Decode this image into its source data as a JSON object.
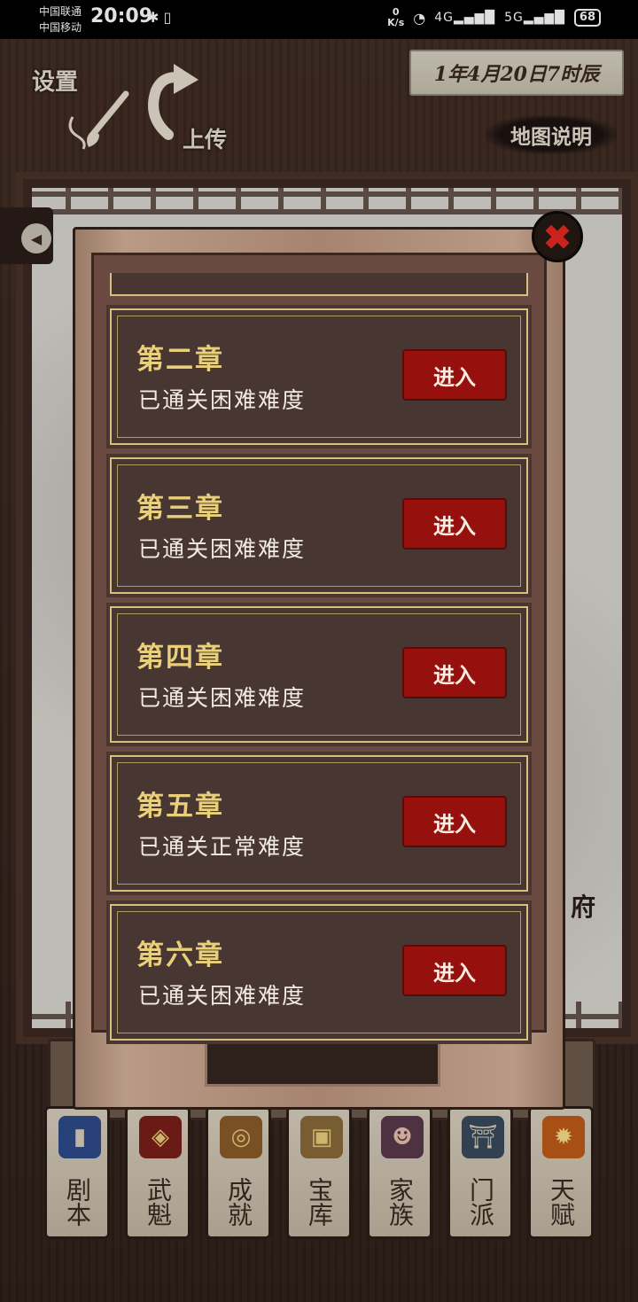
{
  "status_bar": {
    "carrier1": "中国联通",
    "carrier2": "中国移动",
    "time": "20:09",
    "net_speed_value": "0",
    "net_speed_unit": "K/s",
    "signal1": "4G",
    "signal2": "5G",
    "battery": "68"
  },
  "header": {
    "settings_label": "设置",
    "upload_label": "上传",
    "date": "1年4月20日7时辰",
    "map_help": "地图说明"
  },
  "map": {
    "fu_label": "府"
  },
  "modal": {
    "close_glyph": "✖",
    "chapters": [
      {
        "title": "第二章",
        "status": "已通关困难难度",
        "button": "进入"
      },
      {
        "title": "第三章",
        "status": "已通关困难难度",
        "button": "进入"
      },
      {
        "title": "第四章",
        "status": "已通关困难难度",
        "button": "进入"
      },
      {
        "title": "第五章",
        "status": "已通关正常难度",
        "button": "进入"
      },
      {
        "title": "第六章",
        "status": "已通关困难难度",
        "button": "进入"
      }
    ]
  },
  "tabbar": [
    {
      "label": "剧本",
      "icon": "book-icon",
      "color": "#2f4a8a"
    },
    {
      "label": "武魁",
      "icon": "banner-icon",
      "color": "#7a1f18"
    },
    {
      "label": "成就",
      "icon": "coins-icon",
      "color": "#8a5a2a"
    },
    {
      "label": "宝库",
      "icon": "chest-icon",
      "color": "#8a6a3a"
    },
    {
      "label": "家族",
      "icon": "family-icon",
      "color": "#5a3a4a"
    },
    {
      "label": "门派",
      "icon": "gate-icon",
      "color": "#3a4a5a"
    },
    {
      "label": "天赋",
      "icon": "flame-icon",
      "color": "#c05a1a"
    }
  ]
}
